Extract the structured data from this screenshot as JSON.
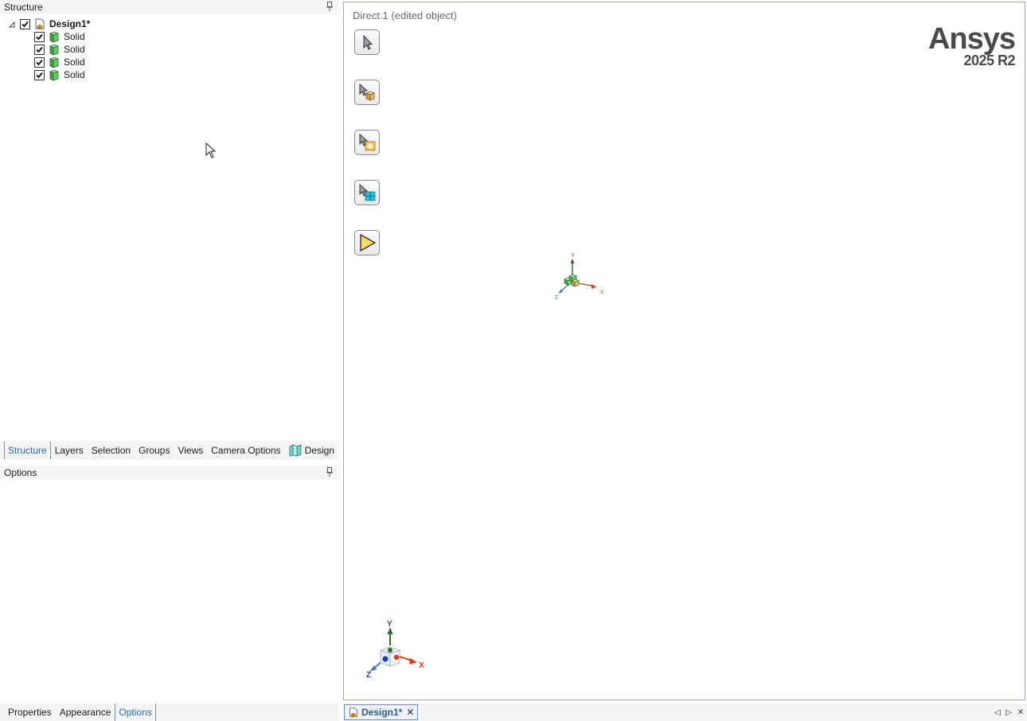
{
  "structure_panel": {
    "title": "Structure",
    "tree": {
      "root": {
        "label": "Design1*",
        "checked": true
      },
      "children": [
        {
          "label": "Solid",
          "checked": true
        },
        {
          "label": "Solid",
          "checked": true
        },
        {
          "label": "Solid",
          "checked": true
        },
        {
          "label": "Solid",
          "checked": true
        }
      ]
    },
    "tabs": [
      {
        "label": "Structure",
        "active": true
      },
      {
        "label": "Layers",
        "active": false
      },
      {
        "label": "Selection",
        "active": false
      },
      {
        "label": "Groups",
        "active": false
      },
      {
        "label": "Views",
        "active": false
      },
      {
        "label": "Camera Options",
        "active": false
      },
      {
        "label": "Design",
        "active": false
      }
    ]
  },
  "options_panel": {
    "title": "Options",
    "tabs": [
      {
        "label": "Properties",
        "active": false
      },
      {
        "label": "Appearance",
        "active": false
      },
      {
        "label": "Options",
        "active": true
      }
    ]
  },
  "viewport": {
    "title": "Direct.1 (edited object)",
    "brand": {
      "name": "Ansys",
      "version": "2025 R2"
    },
    "tools": [
      {
        "name": "select-tool"
      },
      {
        "name": "select-body-tool"
      },
      {
        "name": "select-point-tool"
      },
      {
        "name": "select-face-tool"
      },
      {
        "name": "complete-tool"
      }
    ],
    "triad_labels": {
      "x": "X",
      "y": "Y",
      "z": "Z"
    }
  },
  "document_tabs": [
    {
      "label": "Design1*",
      "close": "✕"
    }
  ],
  "nav_controls": {
    "prev": "◁",
    "next": "▷",
    "close": "✕"
  },
  "colors": {
    "panel_bg": "#f4f5f7",
    "active_tab": "#2a6aa8",
    "viewport_border": "#a8a890",
    "brand": "#4a4a4a",
    "axis_x": "#d9401a",
    "axis_y": "#2a6a2a",
    "axis_z": "#2a4ab0"
  }
}
